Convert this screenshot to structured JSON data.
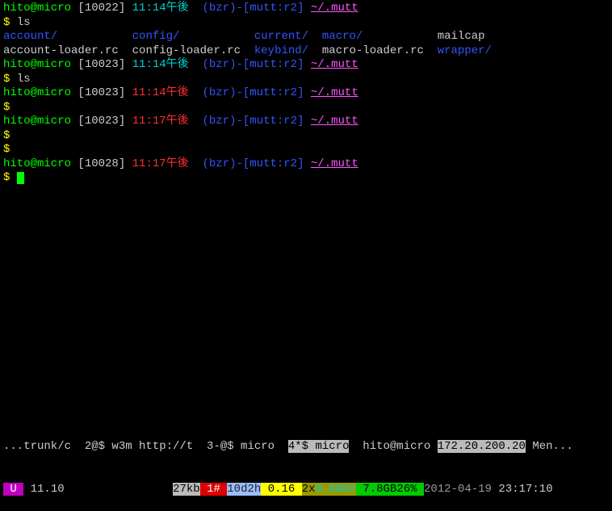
{
  "prompts": [
    {
      "user": "hito",
      "host": "micro",
      "hist": "10022",
      "time": "11:14午後",
      "vcs": "(bzr)-[mutt:r2]",
      "path": "~/.mutt",
      "cmd": "ls",
      "timeColor": "cyan"
    },
    {
      "user": "hito",
      "host": "micro",
      "hist": "10023",
      "time": "11:14午後",
      "vcs": "(bzr)-[mutt:r2]",
      "path": "~/.mutt",
      "cmd": "ls",
      "timeColor": "cyan"
    },
    {
      "user": "hito",
      "host": "micro",
      "hist": "10023",
      "time": "11:14午後",
      "vcs": "(bzr)-[mutt:r2]",
      "path": "~/.mutt",
      "cmd": "",
      "timeColor": "red"
    },
    {
      "user": "hito",
      "host": "micro",
      "hist": "10023",
      "time": "11:17午後",
      "vcs": "(bzr)-[mutt:r2]",
      "path": "~/.mutt",
      "cmd": "",
      "timeColor": "red"
    },
    {
      "user": "hito",
      "host": "micro",
      "hist": "10028",
      "time": "11:17午後",
      "vcs": "(bzr)-[mutt:r2]",
      "path": "~/.mutt",
      "cmd": "",
      "timeColor": "red",
      "cursor": true
    }
  ],
  "ls": {
    "row1": {
      "c1": "account/",
      "c2": "config/",
      "c3": "current/",
      "c4": "macro/",
      "c5": "mailcap"
    },
    "row2": {
      "c1": "account-loader.rc",
      "c2": "config-loader.rc",
      "c3": "keybind/",
      "c4": "macro-loader.rc",
      "c5": "wrapper/"
    }
  },
  "status_top": {
    "left": "...trunk/c  2@$ w3m http://t  3-@$ micro  ",
    "active": "4*$ micro",
    "userhost": "  hito@micro ",
    "ip": "172.20.200.20",
    "right": " Men..."
  },
  "status_bottom": {
    "u": " U ",
    "ver": " 11.10",
    "kb": "27kb",
    "redhash": " 1# ",
    "uptime": "10d2h",
    "load": " 0.16 ",
    "cpu1": "2x",
    "cpu2": "0.8GHz",
    "mem": " 7.8GB26% ",
    "date": "2012-04-19 ",
    "time": "23:17:10"
  }
}
